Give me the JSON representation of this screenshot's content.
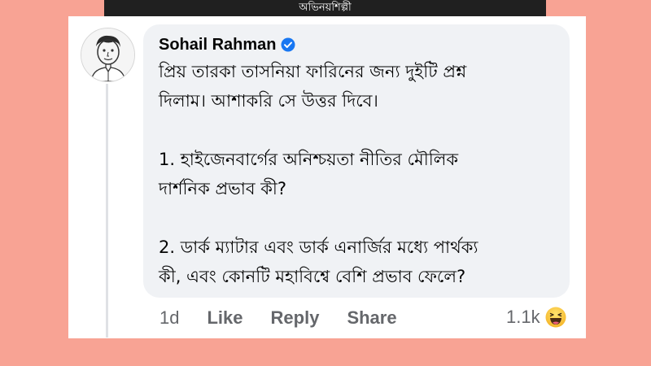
{
  "top_caption": "অভিনয়শিল্পী",
  "comment": {
    "author": "Sohail Rahman",
    "verified_icon": "verified-badge-icon",
    "avatar_icon": "sketch-portrait-avatar",
    "lines": {
      "intro_1": "প্রিয় তারকা তাসনিয়া ফারিনের জন্য দুইটি প্রশ্ন",
      "intro_2": "দিলাম। আশাকরি সে উত্তর দিবে।",
      "q1_1": "1. হাইজেনবার্গের অনিশ্চয়তা নীতির মৌলিক",
      "q1_2": "দার্শনিক প্রভাব কী?",
      "q2_1": "2. ডার্ক ম্যাটার এবং ডার্ক এনার্জির মধ্যে পার্থক্য",
      "q2_2": "কী, এবং কোনটি মহাবিশ্বে বেশি প্রভাব ফেলে?"
    },
    "time": "1d",
    "like_label": "Like",
    "reply_label": "Reply",
    "share_label": "Share",
    "reaction_count": "1.1k",
    "reaction_icon": "haha-emoji-icon"
  },
  "colors": {
    "background": "#f8a394",
    "bubble": "#f0f2f5",
    "verified": "#1877f2",
    "muted_text": "#65676b"
  }
}
